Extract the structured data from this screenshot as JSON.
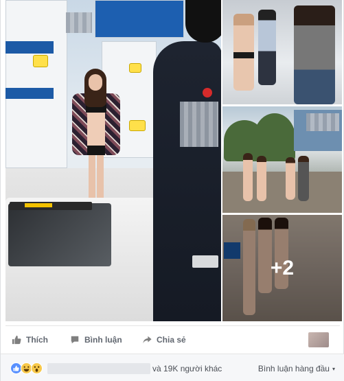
{
  "post": {
    "photos": {
      "more_count": "+2"
    },
    "actions": {
      "like_label": "Thích",
      "comment_label": "Bình luận",
      "share_label": "Chia sẻ"
    },
    "reactions": {
      "icons": [
        "like-icon",
        "haha-icon",
        "wow-icon"
      ],
      "others_text": "và 19K người khác",
      "sort_label": "Bình luận hàng đầu",
      "sort_caret": "▾"
    }
  },
  "colors": {
    "like_blue": "#5890ff",
    "action_gray": "#616770",
    "text_dark": "#4b4f56",
    "reaction_bar_bg": "#f6f7f9"
  }
}
